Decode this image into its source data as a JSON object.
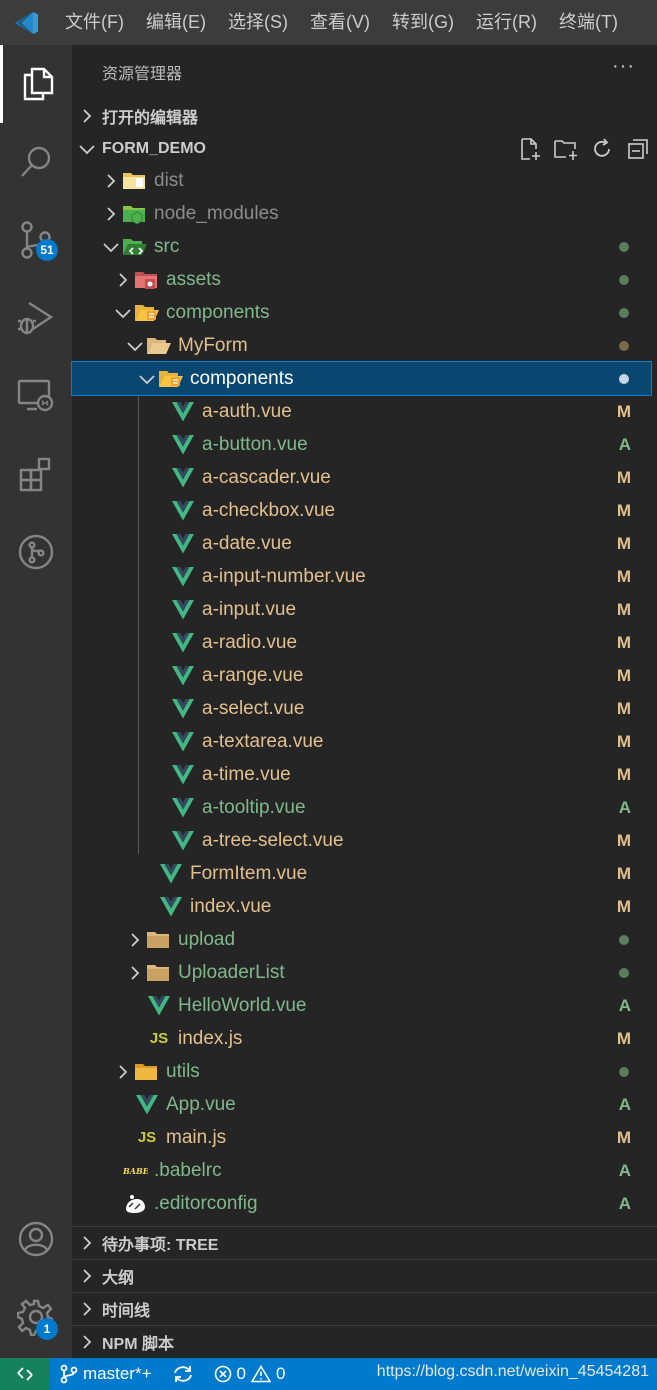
{
  "menu": [
    "文件(F)",
    "编辑(E)",
    "选择(S)",
    "查看(V)",
    "转到(G)",
    "运行(R)",
    "终端(T)"
  ],
  "activity": {
    "scm_badge": "51",
    "settings_badge": "1"
  },
  "sidebar": {
    "title": "资源管理器",
    "more": "···",
    "open_editors": "打开的编辑器",
    "workspace": "FORM_DEMO"
  },
  "tree": [
    {
      "label": "dist",
      "depth": 0,
      "kind": "folder",
      "expanded": false,
      "icon": "dist-folder-icon",
      "color": "ignored",
      "status": ""
    },
    {
      "label": "node_modules",
      "depth": 0,
      "kind": "folder",
      "expanded": false,
      "icon": "node-folder-icon",
      "color": "ignored",
      "status": ""
    },
    {
      "label": "src",
      "depth": 0,
      "kind": "folder",
      "expanded": true,
      "icon": "src-folder-icon",
      "color": "add",
      "status": "dot-green"
    },
    {
      "label": "assets",
      "depth": 1,
      "kind": "folder",
      "expanded": false,
      "icon": "assets-folder-icon",
      "color": "add",
      "status": "dot-green"
    },
    {
      "label": "components",
      "depth": 1,
      "kind": "folder",
      "expanded": true,
      "icon": "components-folder-icon",
      "color": "add",
      "status": "dot-green"
    },
    {
      "label": "MyForm",
      "depth": 2,
      "kind": "folder",
      "expanded": true,
      "icon": "folder-open-icon",
      "color": "mod",
      "status": "dot-brown"
    },
    {
      "label": "components",
      "depth": 3,
      "kind": "folder",
      "expanded": true,
      "icon": "components-folder-icon",
      "color": "sel",
      "status": "dot-sel",
      "selected": true
    },
    {
      "label": "a-auth.vue",
      "depth": 4,
      "kind": "vue",
      "color": "mod",
      "status": "M"
    },
    {
      "label": "a-button.vue",
      "depth": 4,
      "kind": "vue",
      "color": "add",
      "status": "A"
    },
    {
      "label": "a-cascader.vue",
      "depth": 4,
      "kind": "vue",
      "color": "mod",
      "status": "M"
    },
    {
      "label": "a-checkbox.vue",
      "depth": 4,
      "kind": "vue",
      "color": "mod",
      "status": "M"
    },
    {
      "label": "a-date.vue",
      "depth": 4,
      "kind": "vue",
      "color": "mod",
      "status": "M"
    },
    {
      "label": "a-input-number.vue",
      "depth": 4,
      "kind": "vue",
      "color": "mod",
      "status": "M"
    },
    {
      "label": "a-input.vue",
      "depth": 4,
      "kind": "vue",
      "color": "mod",
      "status": "M"
    },
    {
      "label": "a-radio.vue",
      "depth": 4,
      "kind": "vue",
      "color": "mod",
      "status": "M"
    },
    {
      "label": "a-range.vue",
      "depth": 4,
      "kind": "vue",
      "color": "mod",
      "status": "M"
    },
    {
      "label": "a-select.vue",
      "depth": 4,
      "kind": "vue",
      "color": "mod",
      "status": "M"
    },
    {
      "label": "a-textarea.vue",
      "depth": 4,
      "kind": "vue",
      "color": "mod",
      "status": "M"
    },
    {
      "label": "a-time.vue",
      "depth": 4,
      "kind": "vue",
      "color": "mod",
      "status": "M"
    },
    {
      "label": "a-tooltip.vue",
      "depth": 4,
      "kind": "vue",
      "color": "add",
      "status": "A"
    },
    {
      "label": "a-tree-select.vue",
      "depth": 4,
      "kind": "vue",
      "color": "mod",
      "status": "M"
    },
    {
      "label": "FormItem.vue",
      "depth": 3,
      "kind": "vue",
      "color": "mod",
      "status": "M"
    },
    {
      "label": "index.vue",
      "depth": 3,
      "kind": "vue",
      "color": "mod",
      "status": "M"
    },
    {
      "label": "upload",
      "depth": 2,
      "kind": "folder",
      "expanded": false,
      "icon": "folder-icon",
      "color": "add",
      "status": "dot-green"
    },
    {
      "label": "UploaderList",
      "depth": 2,
      "kind": "folder",
      "expanded": false,
      "icon": "folder-icon",
      "color": "add",
      "status": "dot-green"
    },
    {
      "label": "HelloWorld.vue",
      "depth": 2,
      "kind": "vue",
      "color": "add",
      "status": "A"
    },
    {
      "label": "index.js",
      "depth": 2,
      "kind": "js",
      "color": "mod",
      "status": "M"
    },
    {
      "label": "utils",
      "depth": 1,
      "kind": "folder",
      "expanded": false,
      "icon": "utils-folder-icon",
      "color": "add",
      "status": "dot-green"
    },
    {
      "label": "App.vue",
      "depth": 1,
      "kind": "vue",
      "color": "add",
      "status": "A"
    },
    {
      "label": "main.js",
      "depth": 1,
      "kind": "js",
      "color": "mod",
      "status": "M"
    },
    {
      "label": ".babelrc",
      "depth": 0,
      "kind": "babel",
      "color": "add",
      "status": "A"
    },
    {
      "label": ".editorconfig",
      "depth": 0,
      "kind": "editorconfig",
      "color": "add",
      "status": "A"
    }
  ],
  "panels": [
    "待办事项: TREE",
    "大纲",
    "时间线",
    "NPM 脚本"
  ],
  "statusbar": {
    "branch": "master*+",
    "errors": "0",
    "warnings": "0",
    "watermark": "https://blog.csdn.net/weixin_45454281"
  },
  "colors": {
    "modified": "#e2c08d",
    "added": "#81b88b",
    "ignored": "#8c8c8c",
    "accent": "#007acc",
    "vue": "#41b883"
  }
}
